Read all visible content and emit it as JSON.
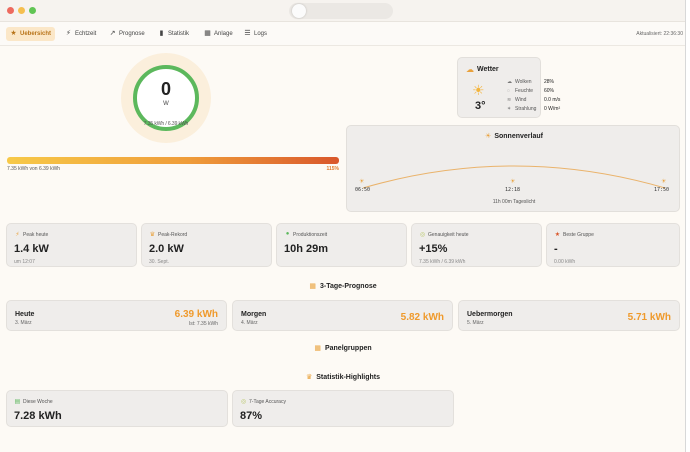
{
  "nav": {
    "items": [
      {
        "label": "Uebersicht",
        "icon": "★"
      },
      {
        "label": "Echtzeit",
        "icon": "⚡"
      },
      {
        "label": "Prognose",
        "icon": "↗"
      },
      {
        "label": "Statistik",
        "icon": "▮"
      },
      {
        "label": "Anlage",
        "icon": "▦"
      },
      {
        "label": "Logs",
        "icon": "☰"
      }
    ],
    "last_update": "Aktualisiert: 22:36:30"
  },
  "power": {
    "value": "0",
    "unit": "W",
    "sub": "7.35 kWh / 6.39 kWh",
    "progress_fraction": 1.0,
    "progress_left": "7.35 kWh von 6.39 kWh",
    "progress_right": "115%"
  },
  "weather": {
    "title": "Wetter",
    "temp": "3°",
    "rows": [
      {
        "label": "Wolken",
        "value": "28%",
        "icon": "☁"
      },
      {
        "label": "Feuchte",
        "value": "60%",
        "icon": "◌"
      },
      {
        "label": "Wind",
        "value": "0.0 m/s",
        "icon": "≋"
      },
      {
        "label": "Strahlung",
        "value": "0 W/m²",
        "icon": "✶"
      }
    ]
  },
  "sun": {
    "title": "Sonnenverlauf",
    "sunrise": "06:50",
    "noon": "12:18",
    "sunset": "17:50",
    "daylight": "11h 00m Tageslicht"
  },
  "stats": [
    {
      "label": "Peak heute",
      "value": "1.4 kW",
      "sub": "um 12:07",
      "icon": "⚡",
      "color": "#e9a13b"
    },
    {
      "label": "Peak-Rekord",
      "value": "2.0 kW",
      "sub": "30. Sept.",
      "icon": "♛",
      "color": "#e9a13b"
    },
    {
      "label": "Produktionszeit",
      "value": "10h 29m",
      "sub": "",
      "icon": "●",
      "color": "#5cb85c"
    },
    {
      "label": "Genauigkeit heute",
      "value": "+15%",
      "sub": "7.35 kWh / 6.39 kWh",
      "icon": "◎",
      "color": "#b9c76a"
    },
    {
      "label": "Beste Gruppe",
      "value": "-",
      "sub": "0.00 kWh",
      "icon": "★",
      "color": "#d9572b"
    }
  ],
  "forecast": {
    "title": "3-Tage-Prognose",
    "days": [
      {
        "day": "Heute",
        "date": "3. März",
        "value": "6.39 kWh",
        "ist": "Ist: 7.35 kWh"
      },
      {
        "day": "Morgen",
        "date": "4. März",
        "value": "5.82 kWh",
        "ist": ""
      },
      {
        "day": "Uebermorgen",
        "date": "5. März",
        "value": "5.71 kWh",
        "ist": ""
      }
    ]
  },
  "panel_groups": {
    "title": "Panelgruppen"
  },
  "highlights": {
    "title": "Statistik-Highlights",
    "cards": [
      {
        "label": "Diese Woche",
        "value": "7.28 kWh",
        "icon": "▤",
        "color": "#5cb85c"
      },
      {
        "label": "7-Tage Accuracy",
        "value": "87%",
        "icon": "◎",
        "color": "#b9c76a"
      }
    ]
  }
}
